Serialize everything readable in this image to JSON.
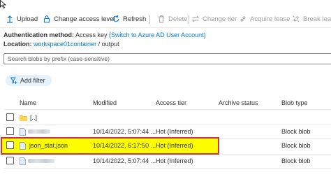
{
  "toolbar": {
    "upload": "Upload",
    "change_access_level": "Change access level",
    "refresh": "Refresh",
    "delete": "Delete",
    "change_tier": "Change tier",
    "acquire_lease": "Acquire lease",
    "break_lease": "Break lease"
  },
  "auth": {
    "label": "Authentication method:",
    "value": "Access key",
    "switch_link": "(Switch to Azure AD User Account)"
  },
  "location": {
    "label": "Location:",
    "container": "workspace01container",
    "separator": "/",
    "folder": "output"
  },
  "search": {
    "placeholder": "Search blobs by prefix (case-sensitive)"
  },
  "filter": {
    "label": "Add filter"
  },
  "table": {
    "columns": {
      "name": "Name",
      "modified": "Modified",
      "access_tier": "Access tier",
      "archive_status": "Archive status",
      "blob_type": "Blob type"
    },
    "parent_row": {
      "name": "[..]"
    },
    "rows": [
      {
        "name": "",
        "modified": "10/14/2022, 5:07:44 ...",
        "access_tier": "Hot (Inferred)",
        "archive_status": "",
        "blob_type": "Block blob"
      },
      {
        "name": "json_stat.json",
        "modified": "10/14/2022, 6:17:50 ...",
        "access_tier": "Hot (Inferred)",
        "archive_status": "",
        "blob_type": "Block blob"
      },
      {
        "name": "",
        "modified": "10/14/2022, 5:07:44 ...",
        "access_tier": "Hot (Inferred)",
        "archive_status": "",
        "blob_type": "Block blob"
      }
    ]
  },
  "colors": {
    "accent": "#0078d4",
    "highlight": "#fefe00",
    "highlight_border": "#d13438",
    "folder": "#f4c22b"
  }
}
